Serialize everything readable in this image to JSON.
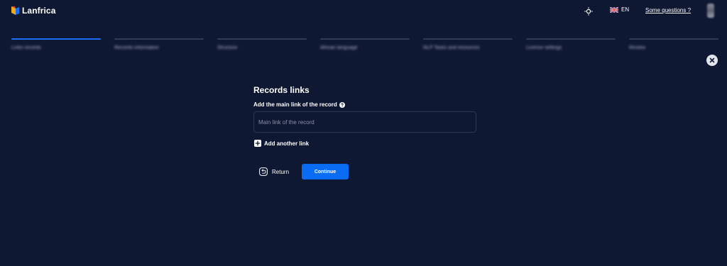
{
  "header": {
    "brand_name": "Lanfrica",
    "language": "EN",
    "help_link": "Some questions ?",
    "icons": {
      "logo": "lanfrica-logo-icon",
      "theme": "sun-icon",
      "flag": "uk-flag-icon",
      "avatar": "user-avatar"
    }
  },
  "stepper": {
    "active_color": "#1a6ef5",
    "inactive_color": "#323a54",
    "steps": [
      {
        "label": "Links records"
      },
      {
        "label": "Records information"
      },
      {
        "label": "Structure"
      },
      {
        "label": "African language"
      },
      {
        "label": "NLP Tasks and resources"
      },
      {
        "label": "Licence settings"
      },
      {
        "label": "Review"
      }
    ]
  },
  "form": {
    "title": "Records links",
    "field_label": "Add the main link of the record",
    "input_placeholder": "Main link of the record",
    "input_value": "",
    "add_link_label": "Add another link",
    "return_label": "Return",
    "continue_label": "Continue"
  },
  "colors": {
    "background": "#0f1833",
    "primary": "#0a6cf2",
    "text": "#ffffff"
  }
}
